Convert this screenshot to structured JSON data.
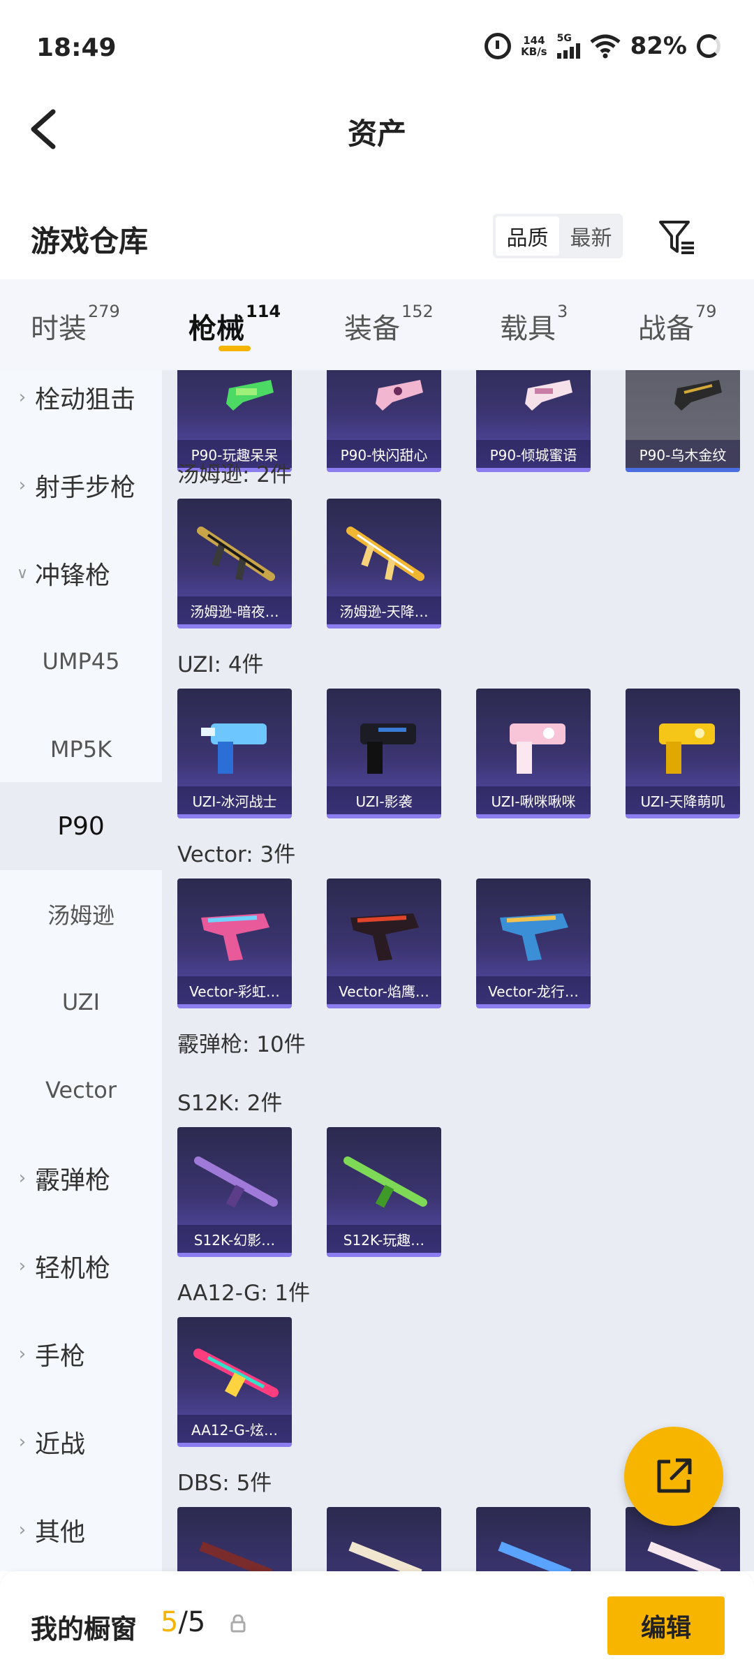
{
  "status_bar": {
    "time": "18:49",
    "net_speed_value": "144",
    "net_speed_unit": "KB/s",
    "network": "5G",
    "battery": "82%"
  },
  "header": {
    "title": "资产"
  },
  "warehouse": {
    "title": "游戏仓库",
    "sort_options": [
      "品质",
      "最新"
    ],
    "active_sort": "品质"
  },
  "tabs": [
    {
      "label": "时装",
      "count": "279"
    },
    {
      "label": "枪械",
      "count": "114",
      "active": true
    },
    {
      "label": "装备",
      "count": "152"
    },
    {
      "label": "载具",
      "count": "3"
    },
    {
      "label": "战备",
      "count": "79"
    }
  ],
  "sidebar": {
    "items": [
      {
        "label": "栓动狙击"
      },
      {
        "label": "射手步枪"
      },
      {
        "label": "冲锋枪",
        "expanded": true
      },
      {
        "label": "UMP45"
      },
      {
        "label": "MP5K"
      },
      {
        "label": "P90",
        "selected": true
      },
      {
        "label": "汤姆逊"
      },
      {
        "label": "UZI"
      },
      {
        "label": "Vector"
      },
      {
        "label": "霰弹枪"
      },
      {
        "label": "轻机枪"
      },
      {
        "label": "手枪"
      },
      {
        "label": "近战"
      },
      {
        "label": "其他"
      }
    ]
  },
  "groups": {
    "p90": {
      "items": [
        "P90-玩趣呆呆",
        "P90-快闪甜心",
        "P90-倾城蜜语",
        "P90-乌木金纹"
      ]
    },
    "thompson": {
      "label": "汤姆逊: 2件",
      "items": [
        "汤姆逊-暗夜…",
        "汤姆逊-天降…"
      ]
    },
    "uzi": {
      "label": "UZI: 4件",
      "items": [
        "UZI-冰河战士",
        "UZI-影袭",
        "UZI-啾咪啾咪",
        "UZI-天降萌叽"
      ]
    },
    "vector": {
      "label": "Vector: 3件",
      "items": [
        "Vector-彩虹…",
        "Vector-焰鹰…",
        "Vector-龙行…"
      ]
    },
    "shotgun": {
      "label": "霰弹枪: 10件"
    },
    "s12k": {
      "label": "S12K: 2件",
      "items": [
        "S12K-幻影…",
        "S12K-玩趣…"
      ]
    },
    "aa12": {
      "label": "AA12-G: 1件",
      "items": [
        "AA12-G-炫…"
      ]
    },
    "dbs": {
      "label": "DBS: 5件"
    }
  },
  "bottom_bar": {
    "title": "我的橱窗",
    "count_current": "5",
    "count_total": "/5",
    "edit_label": "编辑"
  },
  "colors": {
    "accent": "#f7b500",
    "card_purple": "#3b3470"
  }
}
